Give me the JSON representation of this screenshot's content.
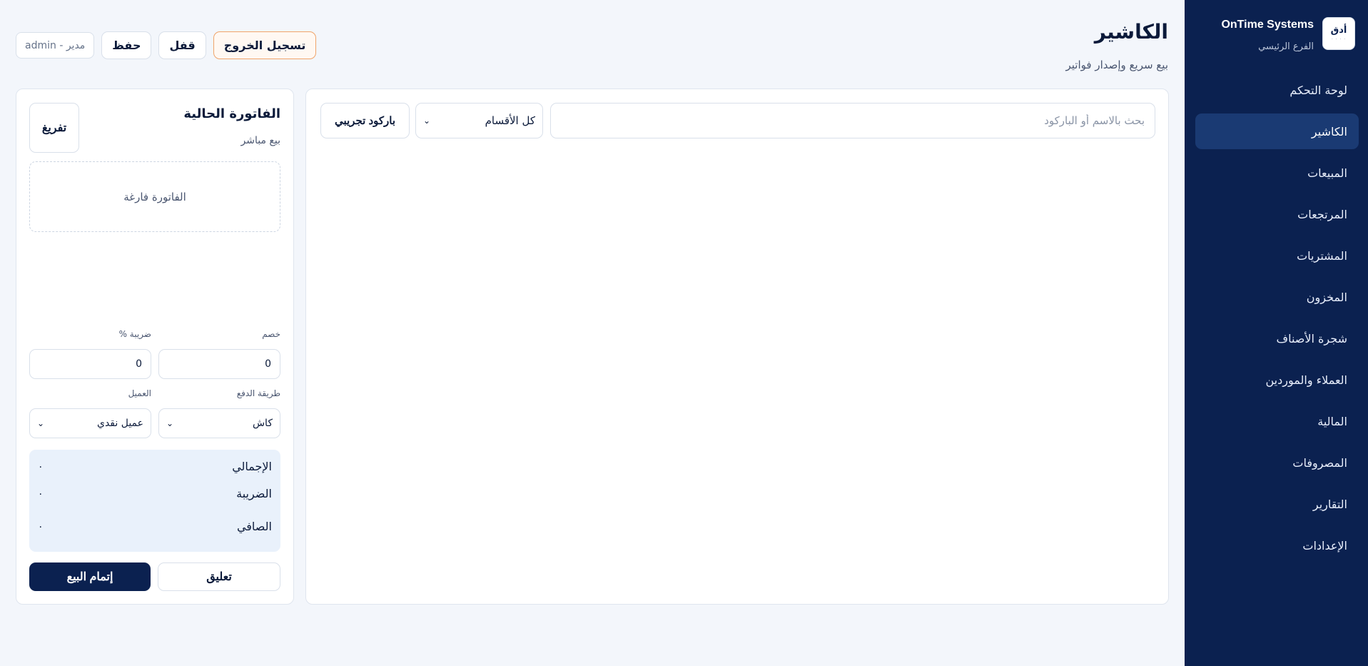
{
  "brand": {
    "name": "OnTime Systems",
    "branch": "الفرع الرئيسي",
    "logo_text": "أدق",
    "logo_sub": "· · · ·"
  },
  "sidebar": {
    "items": [
      {
        "label": "لوحة التحكم"
      },
      {
        "label": "الكاشير",
        "active": true
      },
      {
        "label": "المبيعات"
      },
      {
        "label": "المرتجعات"
      },
      {
        "label": "المشتريات"
      },
      {
        "label": "المخزون"
      },
      {
        "label": "شجرة الأصناف"
      },
      {
        "label": "العملاء والموردين"
      },
      {
        "label": "المالية"
      },
      {
        "label": "المصروفات"
      },
      {
        "label": "التقارير"
      },
      {
        "label": "الإعدادات"
      }
    ]
  },
  "header": {
    "title": "الكاشير",
    "subtitle": "بيع سريع وإصدار فواتير",
    "user": "admin - مدير",
    "save_label": "حفظ",
    "lock_label": "قفل",
    "logout_label": "تسجيل الخروج"
  },
  "products": {
    "search_placeholder": "بحث بالاسم أو الباركود",
    "category_selected": "كل الأقسام",
    "barcode_label": "باركود تجريبي"
  },
  "invoice": {
    "title": "الفاتورة الحالية",
    "subtitle": "بيع مباشر",
    "clear_label": "تفريغ",
    "empty_text": "الفاتورة فارغة",
    "discount_label": "خصم",
    "discount_value": "0",
    "tax_label": "ضريبة %",
    "tax_value": "0",
    "payment_label": "طريقة الدفع",
    "payment_selected": "كاش",
    "customer_label": "العميل",
    "customer_selected": "عميل نقدي",
    "totals": {
      "total_label": "الإجمالي",
      "total_value": "٠",
      "tax_label": "الضريبة",
      "tax_value": "٠",
      "net_label": "الصافي",
      "net_value": "٠"
    },
    "hold_label": "تعليق",
    "complete_label": "إتمام البيع"
  },
  "colors": {
    "sidebar_bg": "#0b2150",
    "active_item": "#1a3a73",
    "accent_logout": "#f0a46a",
    "page_bg": "#f3f6fb"
  }
}
